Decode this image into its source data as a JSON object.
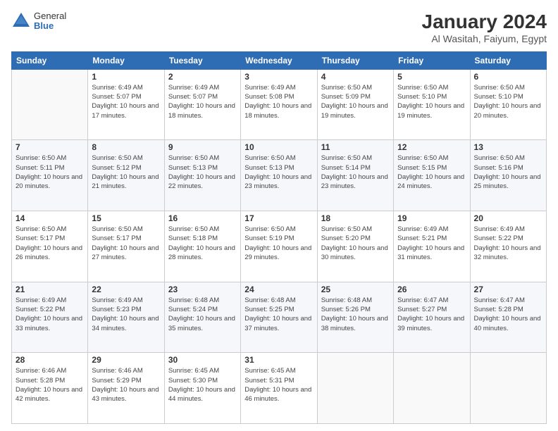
{
  "header": {
    "logo_general": "General",
    "logo_blue": "Blue",
    "title": "January 2024",
    "subtitle": "Al Wasitah, Faiyum, Egypt"
  },
  "days_of_week": [
    "Sunday",
    "Monday",
    "Tuesday",
    "Wednesday",
    "Thursday",
    "Friday",
    "Saturday"
  ],
  "weeks": [
    [
      {
        "day": null
      },
      {
        "day": "1",
        "sunrise": "6:49 AM",
        "sunset": "5:07 PM",
        "daylight": "10 hours and 17 minutes."
      },
      {
        "day": "2",
        "sunrise": "6:49 AM",
        "sunset": "5:07 PM",
        "daylight": "10 hours and 18 minutes."
      },
      {
        "day": "3",
        "sunrise": "6:49 AM",
        "sunset": "5:08 PM",
        "daylight": "10 hours and 18 minutes."
      },
      {
        "day": "4",
        "sunrise": "6:50 AM",
        "sunset": "5:09 PM",
        "daylight": "10 hours and 19 minutes."
      },
      {
        "day": "5",
        "sunrise": "6:50 AM",
        "sunset": "5:10 PM",
        "daylight": "10 hours and 19 minutes."
      },
      {
        "day": "6",
        "sunrise": "6:50 AM",
        "sunset": "5:10 PM",
        "daylight": "10 hours and 20 minutes."
      }
    ],
    [
      {
        "day": "7",
        "sunrise": "6:50 AM",
        "sunset": "5:11 PM",
        "daylight": "10 hours and 20 minutes."
      },
      {
        "day": "8",
        "sunrise": "6:50 AM",
        "sunset": "5:12 PM",
        "daylight": "10 hours and 21 minutes."
      },
      {
        "day": "9",
        "sunrise": "6:50 AM",
        "sunset": "5:13 PM",
        "daylight": "10 hours and 22 minutes."
      },
      {
        "day": "10",
        "sunrise": "6:50 AM",
        "sunset": "5:13 PM",
        "daylight": "10 hours and 23 minutes."
      },
      {
        "day": "11",
        "sunrise": "6:50 AM",
        "sunset": "5:14 PM",
        "daylight": "10 hours and 23 minutes."
      },
      {
        "day": "12",
        "sunrise": "6:50 AM",
        "sunset": "5:15 PM",
        "daylight": "10 hours and 24 minutes."
      },
      {
        "day": "13",
        "sunrise": "6:50 AM",
        "sunset": "5:16 PM",
        "daylight": "10 hours and 25 minutes."
      }
    ],
    [
      {
        "day": "14",
        "sunrise": "6:50 AM",
        "sunset": "5:17 PM",
        "daylight": "10 hours and 26 minutes."
      },
      {
        "day": "15",
        "sunrise": "6:50 AM",
        "sunset": "5:17 PM",
        "daylight": "10 hours and 27 minutes."
      },
      {
        "day": "16",
        "sunrise": "6:50 AM",
        "sunset": "5:18 PM",
        "daylight": "10 hours and 28 minutes."
      },
      {
        "day": "17",
        "sunrise": "6:50 AM",
        "sunset": "5:19 PM",
        "daylight": "10 hours and 29 minutes."
      },
      {
        "day": "18",
        "sunrise": "6:50 AM",
        "sunset": "5:20 PM",
        "daylight": "10 hours and 30 minutes."
      },
      {
        "day": "19",
        "sunrise": "6:49 AM",
        "sunset": "5:21 PM",
        "daylight": "10 hours and 31 minutes."
      },
      {
        "day": "20",
        "sunrise": "6:49 AM",
        "sunset": "5:22 PM",
        "daylight": "10 hours and 32 minutes."
      }
    ],
    [
      {
        "day": "21",
        "sunrise": "6:49 AM",
        "sunset": "5:22 PM",
        "daylight": "10 hours and 33 minutes."
      },
      {
        "day": "22",
        "sunrise": "6:49 AM",
        "sunset": "5:23 PM",
        "daylight": "10 hours and 34 minutes."
      },
      {
        "day": "23",
        "sunrise": "6:48 AM",
        "sunset": "5:24 PM",
        "daylight": "10 hours and 35 minutes."
      },
      {
        "day": "24",
        "sunrise": "6:48 AM",
        "sunset": "5:25 PM",
        "daylight": "10 hours and 37 minutes."
      },
      {
        "day": "25",
        "sunrise": "6:48 AM",
        "sunset": "5:26 PM",
        "daylight": "10 hours and 38 minutes."
      },
      {
        "day": "26",
        "sunrise": "6:47 AM",
        "sunset": "5:27 PM",
        "daylight": "10 hours and 39 minutes."
      },
      {
        "day": "27",
        "sunrise": "6:47 AM",
        "sunset": "5:28 PM",
        "daylight": "10 hours and 40 minutes."
      }
    ],
    [
      {
        "day": "28",
        "sunrise": "6:46 AM",
        "sunset": "5:28 PM",
        "daylight": "10 hours and 42 minutes."
      },
      {
        "day": "29",
        "sunrise": "6:46 AM",
        "sunset": "5:29 PM",
        "daylight": "10 hours and 43 minutes."
      },
      {
        "day": "30",
        "sunrise": "6:45 AM",
        "sunset": "5:30 PM",
        "daylight": "10 hours and 44 minutes."
      },
      {
        "day": "31",
        "sunrise": "6:45 AM",
        "sunset": "5:31 PM",
        "daylight": "10 hours and 46 minutes."
      },
      {
        "day": null
      },
      {
        "day": null
      },
      {
        "day": null
      }
    ]
  ]
}
